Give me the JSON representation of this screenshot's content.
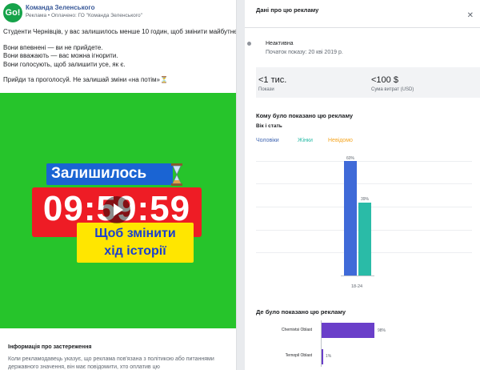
{
  "post": {
    "avatar_text": "Go!",
    "page_name": "Команда Зеленського",
    "sponsor": "Реклама • Оплачено: ГО \"Команда Зеленського\"",
    "lines": [
      "Студенти Чернівців, у вас залишилось менше 10 годин, щоб змінити майбутнє.",
      "",
      "Вони впевнені — ви не прийдете.",
      "Вони вважають — вас можна ігнорити.",
      "Вони голосують, щоб залишити усе, як є.",
      "",
      "Прийди та проголосуй. Не залишай зміни «на потім»⏳"
    ]
  },
  "banner": {
    "top_label": "Залишилось",
    "timer": "09:59:59",
    "bottom_line1": "Щоб змінити",
    "bottom_line2": "хід історії",
    "bg_color": "#26c42b"
  },
  "disclaimer": {
    "title": "Інформація про застереження",
    "text": "Коли рекламодавець указує, що реклама пов'язана з політикою або питаннями державного значення, він має повідомити, хто оплатив цю"
  },
  "details": {
    "title": "Дані про цю рекламу",
    "status": "Неактивна",
    "started": "Початок показу: 20 кві 2019 р.",
    "impressions_value": "<1 тис.",
    "impressions_label": "Покази",
    "spend_value": "<100 $",
    "spend_label": "Сума витрат (USD)"
  },
  "audience": {
    "title": "Кому було показано цю рекламу",
    "subtitle": "Вік і стать",
    "legend_male": "Чоловіки",
    "legend_female": "Жінки",
    "legend_unknown": "Невідомо",
    "male_label": "60%",
    "female_label": "39%",
    "age_group": "18-24"
  },
  "regions": {
    "title": "Де було показано цю рекламу",
    "items": [
      {
        "name": "Chernivtsi Oblast",
        "value_label": "98%"
      },
      {
        "name": "Ternopil Oblast",
        "value_label": "1%"
      }
    ]
  },
  "chart_data": [
    {
      "type": "bar",
      "categories": [
        "18-24"
      ],
      "series": [
        {
          "name": "Чоловіки",
          "values": [
            60
          ]
        },
        {
          "name": "Жінки",
          "values": [
            39
          ]
        },
        {
          "name": "Невідомо",
          "values": [
            0
          ]
        }
      ],
      "ylim": [
        0,
        100
      ]
    },
    {
      "type": "bar",
      "categories": [
        "Chernivtsi Oblast",
        "Ternopil Oblast"
      ],
      "values": [
        98,
        1
      ],
      "ylim": [
        0,
        100
      ]
    }
  ],
  "colors": {
    "male": "#3f6ad8",
    "female": "#2abba7",
    "unknown": "#f5a623",
    "region": "#6a3fc9"
  }
}
